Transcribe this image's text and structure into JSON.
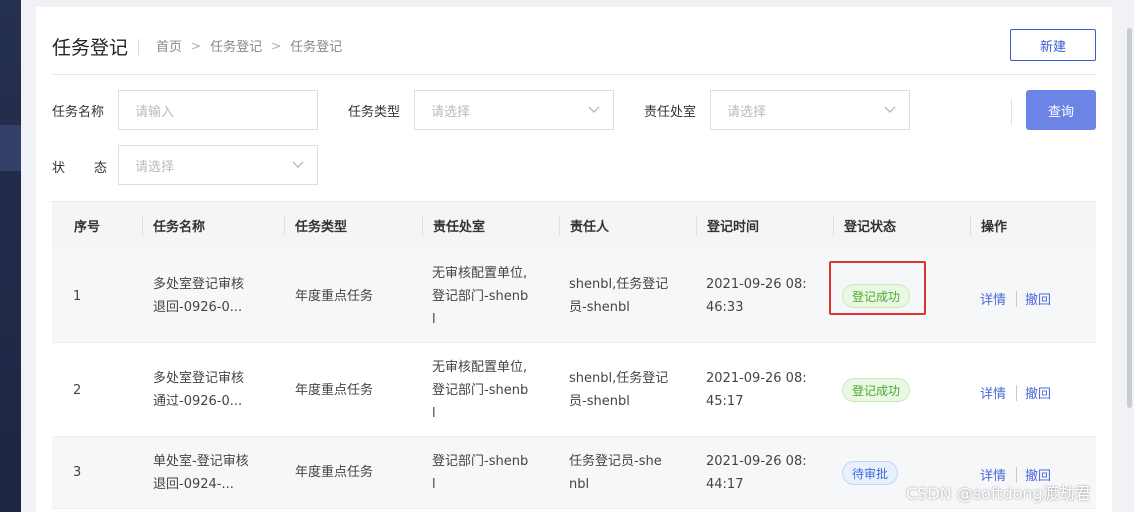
{
  "header": {
    "title": "任务登记",
    "breadcrumb": [
      "首页",
      "任务登记",
      "任务登记"
    ],
    "new_button": "新建"
  },
  "filters": {
    "task_name": {
      "label": "任务名称",
      "placeholder": "请输入"
    },
    "task_type": {
      "label": "任务类型",
      "placeholder": "请选择"
    },
    "responsible_office": {
      "label": "责任处室",
      "placeholder": "请选择"
    },
    "status": {
      "label_1": "状",
      "label_2": "态",
      "placeholder": "请选择"
    },
    "query_button": "查询"
  },
  "table": {
    "columns": [
      "序号",
      "任务名称",
      "任务类型",
      "责任处室",
      "责任人",
      "登记时间",
      "登记状态",
      "操作"
    ],
    "rows": [
      {
        "index": "1",
        "name_1": "多处室登记审核",
        "name_2": "退回-0926-0...",
        "type": "年度重点任务",
        "office_1": "无审核配置单位,",
        "office_2": "登记部门-shenb",
        "office_3": "l",
        "person_1": "shenbl,任务登记",
        "person_2": "员-shenbl",
        "time_1": "2021-09-26 08:",
        "time_2": "46:33",
        "status": "登记成功",
        "action_detail": "详情",
        "action_revoke": "撤回"
      },
      {
        "index": "2",
        "name_1": "多处室登记审核",
        "name_2": "通过-0926-0...",
        "type": "年度重点任务",
        "office_1": "无审核配置单位,",
        "office_2": "登记部门-shenb",
        "office_3": "l",
        "person_1": "shenbl,任务登记",
        "person_2": "员-shenbl",
        "time_1": "2021-09-26 08:",
        "time_2": "45:17",
        "status": "登记成功",
        "action_detail": "详情",
        "action_revoke": "撤回"
      },
      {
        "index": "3",
        "name_1": "单处室-登记审核",
        "name_2": "退回-0924-...",
        "type": "年度重点任务",
        "office_1": "登记部门-shenb",
        "office_2": "l",
        "person_1": "任务登记员-she",
        "person_2": "nbl",
        "time_1": "2021-09-26 08:",
        "time_2": "44:17",
        "status": "待审批",
        "action_detail": "详情",
        "action_revoke": "撤回"
      }
    ]
  },
  "watermark": "CSDN @softdong渡劫君",
  "colors": {
    "primary": "#3a5bd9",
    "query_button": "#6b84e6",
    "success": "#4cab2a",
    "pending": "#3c6fd8",
    "highlight_box": "#e03131"
  }
}
